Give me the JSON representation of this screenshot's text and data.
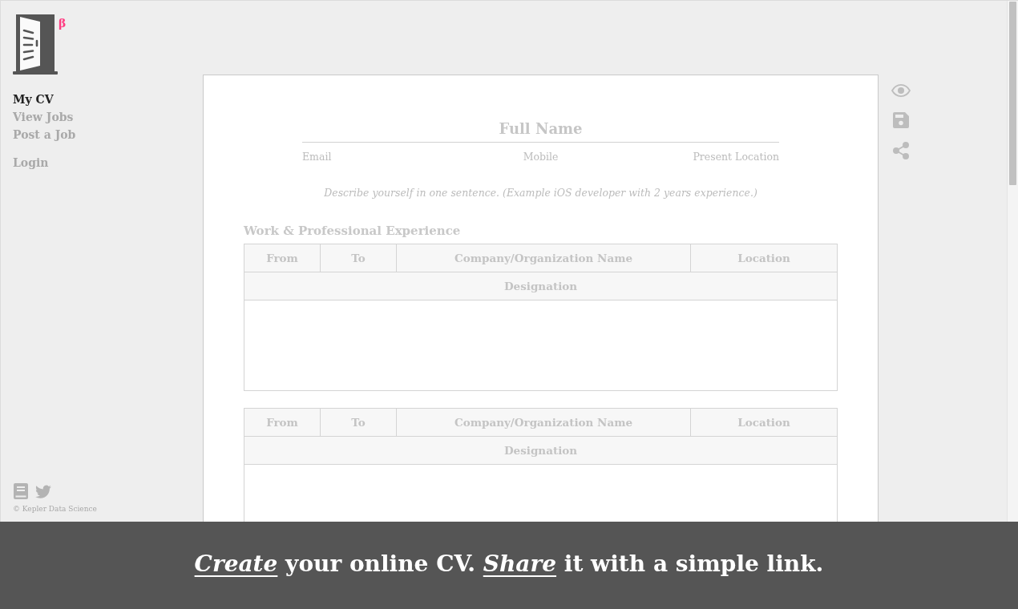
{
  "sidebar": {
    "logo": {
      "badge": "β"
    },
    "nav": [
      {
        "label": "My CV",
        "selected": true
      },
      {
        "label": "View Jobs",
        "selected": false
      },
      {
        "label": "Post a Job",
        "selected": false
      }
    ],
    "login": {
      "label": "Login"
    },
    "footer": {
      "copyright": "© Kepler Data Science"
    }
  },
  "cv": {
    "full_name": {
      "placeholder": "Full Name"
    },
    "contact": [
      {
        "placeholder": "Email"
      },
      {
        "placeholder": "Mobile"
      },
      {
        "placeholder": "Present Location"
      }
    ],
    "summary": {
      "placeholder": "Describe yourself in one sentence. (Example iOS developer with 2 years experience.)"
    },
    "experience": {
      "heading": "Work & Professional Experience",
      "entries": [
        {
          "columns": [
            {
              "placeholder": "From"
            },
            {
              "placeholder": "To"
            },
            {
              "placeholder": "Company/Organization Name"
            },
            {
              "placeholder": "Location"
            }
          ],
          "designation": {
            "placeholder": "Designation"
          }
        },
        {
          "columns": [
            {
              "placeholder": "From"
            },
            {
              "placeholder": "To"
            },
            {
              "placeholder": "Company/Organization Name"
            },
            {
              "placeholder": "Location"
            }
          ],
          "designation": {
            "placeholder": "Designation"
          }
        }
      ]
    }
  },
  "banner": {
    "text": "*Create* your online CV. *Share* it with a simple link."
  }
}
